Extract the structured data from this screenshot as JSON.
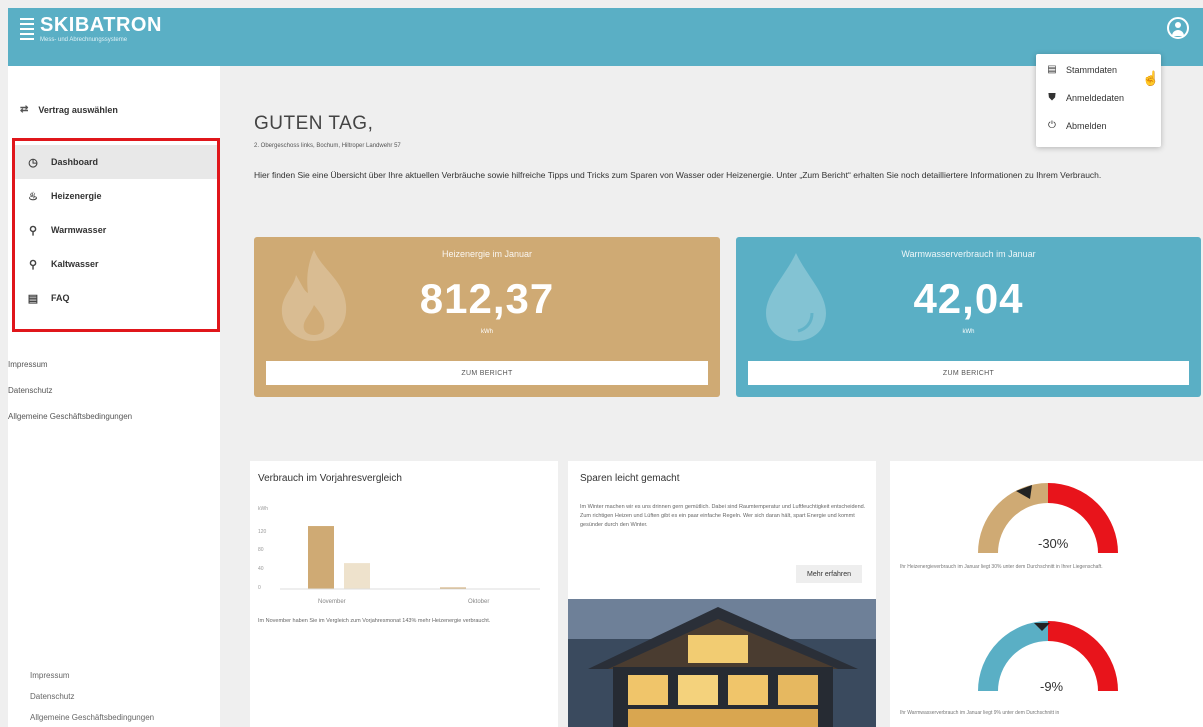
{
  "header": {
    "logo_title": "SKIBATRON",
    "logo_subtitle": "Mess- und Abrechnungssysteme"
  },
  "user_menu": {
    "items": [
      {
        "label": "Stammdaten",
        "icon": "document-icon"
      },
      {
        "label": "Anmeldedaten",
        "icon": "shield-icon"
      },
      {
        "label": "Abmelden",
        "icon": "power-icon"
      }
    ]
  },
  "sidebar": {
    "contract_label": "Vertrag auswählen",
    "nav": [
      {
        "label": "Dashboard",
        "icon": "clock-icon",
        "active": true
      },
      {
        "label": "Heizenergie",
        "icon": "flame-icon"
      },
      {
        "label": "Warmwasser",
        "icon": "tap-icon"
      },
      {
        "label": "Kaltwasser",
        "icon": "tap-icon"
      },
      {
        "label": "FAQ",
        "icon": "faq-icon"
      }
    ],
    "links": [
      "Impressum",
      "Datenschutz",
      "Allgemeine Geschäftsbedingungen"
    ],
    "footer_links": [
      "Impressum",
      "Datenschutz",
      "Allgemeine Geschäftsbedingungen"
    ]
  },
  "main": {
    "greeting": "GUTEN TAG,",
    "address": "2. Obergeschoss links, Bochum, Hiltroper Landwehr 57",
    "intro": "Hier finden Sie eine Übersicht über Ihre aktuellen Verbräuche sowie hilfreiche Tipps und Tricks zum Sparen von Wasser oder Heizenergie. Unter „Zum Bericht“ erhalten Sie noch detailliertere Informationen zu Ihrem Verbrauch.",
    "heat_card": {
      "label": "Heizenergie im Januar",
      "value": "812,37",
      "unit": "kWh",
      "button": "ZUM BERICHT",
      "color": "#cfaa74"
    },
    "water_card": {
      "label": "Warmwasserverbrauch im Januar",
      "value": "42,04",
      "unit": "kWh",
      "button": "ZUM BERICHT",
      "color": "#5aafc5"
    }
  },
  "comparison": {
    "title": "Verbrauch im Vorjahresvergleich",
    "description": "Im November haben Sie im Vergleich zum Vorjahresmonat 143% mehr Heizenergie verbraucht."
  },
  "chart_data": {
    "type": "bar",
    "categories": [
      "November",
      "Oktober"
    ],
    "series": [
      {
        "values": [
          124,
          3
        ],
        "color": "#cfaa74"
      },
      {
        "values": [
          51,
          0
        ],
        "color": "#eee2cc"
      }
    ],
    "ylabel": "kWh",
    "yticks": [
      "120",
      "80",
      "40",
      "0"
    ],
    "ylim": [
      0,
      130
    ]
  },
  "tips": {
    "title": "Sparen leicht gemacht",
    "text": "Im Winter machen wir es uns drinnen gern gemütlich. Dabei sind Raumtemperatur und Luftfeuchtigkeit entscheidend. Zum richtigen Heizen und Lüften gibt es ein paar einfache Regeln. Wer sich daran hält, spart Energie und kommt gesünder durch den Winter.",
    "button": "Mehr erfahren"
  },
  "gauges": [
    {
      "percent": "-30%",
      "description": "Ihr Heizenergieverbrauch im Januar liegt 30% unter dem Durchschnitt in Ihrer Liegenschaft.",
      "color": "#cfaa74"
    },
    {
      "percent": "-9%",
      "description": "Ihr Warmwasserverbrauch im Januar liegt 9% unter dem Durchschnitt in",
      "color": "#5aafc5"
    }
  ]
}
